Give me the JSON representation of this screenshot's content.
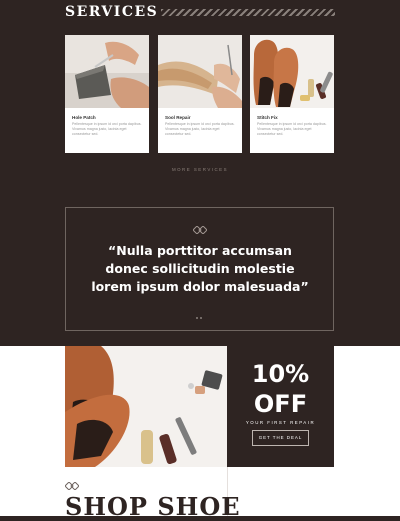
{
  "services": {
    "title": "SERVICES",
    "cards": [
      {
        "title": "Hole Patch",
        "desc": "Pellentesque in ipsum id orci porta dapibus. Vivamus magna justo, lacinia eget consectetur sed."
      },
      {
        "title": "Sool Repair",
        "desc": "Pellentesque in ipsum id orci porta dapibus. Vivamus magna justo, lacinia eget consectetur sed."
      },
      {
        "title": "Stitch Fix",
        "desc": "Pellentesque in ipsum id orci porta dapibus. Vivamus magna justo, lacinia eget consectetur sed."
      }
    ],
    "more_label": "MORE SERVICES"
  },
  "testimonial": {
    "quote": "“Nulla porttitor accumsan donec sollicitudin molestie lorem ipsum dolor malesuada”"
  },
  "promo": {
    "percent": "10%",
    "off": "OFF",
    "subtitle": "YOUR FIRST REPAIR",
    "button_label": "GET THE DEAL"
  },
  "shop": {
    "title": "SHOP SHOE"
  },
  "colors": {
    "dark_bg": "#2e2422",
    "accent_brown": "#b46a3c"
  }
}
